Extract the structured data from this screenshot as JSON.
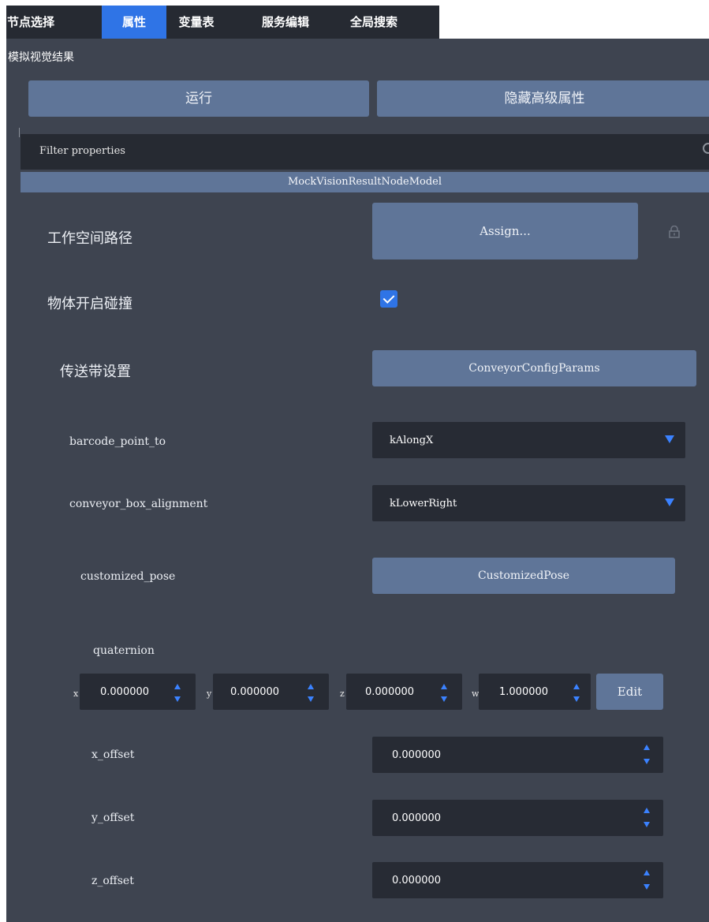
{
  "tabs": [
    {
      "label": "节点选择",
      "active": false
    },
    {
      "label": "属性",
      "active": true
    },
    {
      "label": "变量表",
      "active": false
    },
    {
      "label": "服务编辑",
      "active": false
    },
    {
      "label": "全局搜索",
      "active": false
    }
  ],
  "panel_title": "模拟视觉结果",
  "buttons": {
    "run": "运行",
    "hide_advanced": "隐藏高级属性"
  },
  "filter": {
    "placeholder": "Filter properties"
  },
  "model_name": "MockVisionResultNodeModel",
  "properties": {
    "workspace_path": {
      "label": "工作空间路径",
      "button": "Assign..."
    },
    "object_collision": {
      "label": "物体开启碰撞",
      "checked": true
    },
    "conveyor_settings": {
      "label": "传送带设置",
      "button": "ConveyorConfigParams"
    },
    "barcode_point_to": {
      "label": "barcode_point_to",
      "value": "kAlongX"
    },
    "conveyor_box_alignment": {
      "label": "conveyor_box_alignment",
      "value": "kLowerRight"
    },
    "customized_pose": {
      "label": "customized_pose",
      "button": "CustomizedPose"
    },
    "quaternion": {
      "label": "quaternion",
      "x": {
        "axis": "x",
        "value": "0.000000"
      },
      "y": {
        "axis": "y",
        "value": "0.000000"
      },
      "z": {
        "axis": "z",
        "value": "0.000000"
      },
      "w": {
        "axis": "w",
        "value": "1.000000"
      },
      "edit": "Edit"
    },
    "x_offset": {
      "label": "x_offset",
      "value": "0.000000"
    },
    "y_offset": {
      "label": "y_offset",
      "value": "0.000000"
    },
    "z_offset": {
      "label": "z_offset",
      "value": "0.000000"
    }
  },
  "colors": {
    "background": "#3e4450",
    "accent": "#2f74e6",
    "button": "#5f7598",
    "field": "#272b34",
    "spin_arrow": "#3b82ff"
  },
  "icons": {
    "search": "search-icon",
    "lock": "lock-icon",
    "check": "check-icon",
    "dropdown": "chevron-down-icon"
  }
}
